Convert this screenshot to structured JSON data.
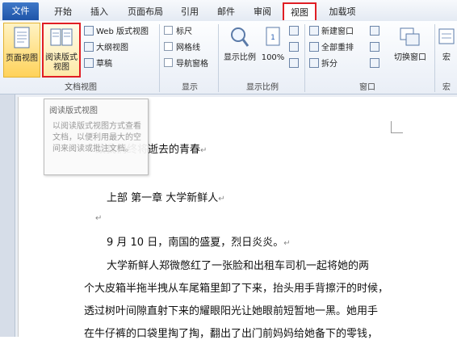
{
  "tabs": [
    "文件",
    "开始",
    "插入",
    "页面布局",
    "引用",
    "邮件",
    "审阅",
    "视图",
    "加载项"
  ],
  "active_tab": "视图",
  "ribbon": {
    "doc_views": {
      "label": "文档视图",
      "print_layout": "页面视图",
      "read_layout_1": "阅读版式",
      "read_layout_2": "视图",
      "web_layout": "Web 版式视图",
      "outline": "大纲视图",
      "draft": "草稿"
    },
    "show": {
      "label": "显示",
      "ruler": "标尺",
      "gridlines": "网格线",
      "nav_pane": "导航窗格"
    },
    "zoom": {
      "label": "显示比例",
      "zoom_btn": "显示比例",
      "hundred": "100%"
    },
    "window": {
      "label": "窗口",
      "new_window": "新建窗口",
      "arrange_all": "全部重排",
      "split": "拆分",
      "switch_window": "切换窗口"
    },
    "macros": {
      "label": "宏",
      "btn": "宏"
    }
  },
  "tooltip": {
    "title": "阅读版式视图",
    "body": "以阅读版式视图方式查看文档，以便利用最大的空间来阅读或批注文档。"
  },
  "document": {
    "title": "致我们终将逝去的青春",
    "part": "上部  第一章  大学新鲜人",
    "date_line": "9 月 10 日，南国的盛夏，烈日炎炎。",
    "p1": "大学新鲜人郑微憋红了一张脸和出租车司机一起将她的两",
    "p2": "个大皮箱半拖半拽从车尾箱里卸了下来，抬头用手背擦汗的时候，",
    "p3": "透过树叶间隙直射下来的耀眼阳光让她眼前短暂地一黑。她用手",
    "p4": "在牛仔裤的口袋里掏了掏，翻出了出门前妈妈给她备下的零钱，",
    "para_mark": "↵"
  },
  "colors": {
    "highlight": "#e01e24",
    "file_tab": "#2a5fb3",
    "active_btn": "#ffd96b"
  }
}
